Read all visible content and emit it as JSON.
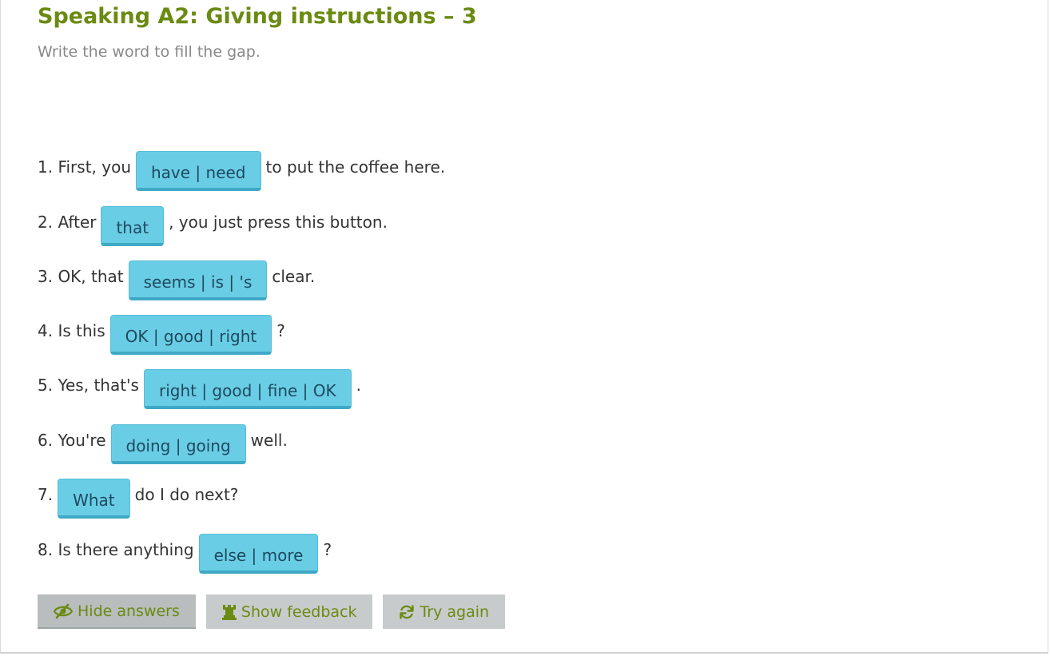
{
  "header": {
    "title": "Speaking A2: Giving instructions – 3",
    "instructions": "Write the word to fill the gap."
  },
  "questions": [
    {
      "before": "1. First, you",
      "answer": "have | need",
      "after": "to put the coffee here."
    },
    {
      "before": "2. After",
      "answer": "that",
      "after": ", you just press this button."
    },
    {
      "before": "3. OK, that",
      "answer": "seems | is | 's",
      "after": "clear."
    },
    {
      "before": "4. Is this",
      "answer": "OK | good | right",
      "after": "?"
    },
    {
      "before": "5. Yes, that's",
      "answer": "right | good | fine | OK",
      "after": "."
    },
    {
      "before": "6. You're",
      "answer": "doing | going",
      "after": "well."
    },
    {
      "before": "7.",
      "answer": "What",
      "after": "do I do next?"
    },
    {
      "before": "8. Is there anything",
      "answer": "else | more",
      "after": "?"
    }
  ],
  "buttons": {
    "hide_answers": {
      "label": "Hide answers",
      "icon": "eye-slash-icon"
    },
    "show_feedback": {
      "label": "Show feedback",
      "icon": "chess-rook-icon"
    },
    "try_again": {
      "label": "Try again",
      "icon": "refresh-icon"
    }
  },
  "colors": {
    "title": "#6b8a12",
    "answer_bg": "#6acde6",
    "button_bg": "#c8cbcb",
    "button_text": "#6b8a12"
  }
}
